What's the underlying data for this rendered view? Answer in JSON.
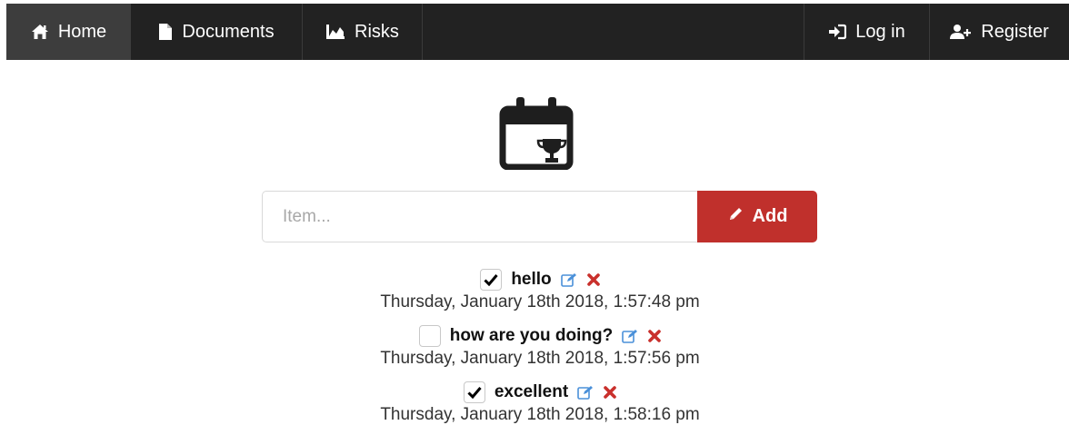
{
  "nav": {
    "left": [
      {
        "label": "Home",
        "icon": "home-icon",
        "active": true
      },
      {
        "label": "Documents",
        "icon": "document-icon",
        "active": false
      },
      {
        "label": "Risks",
        "icon": "chart-icon",
        "active": false
      }
    ],
    "right": [
      {
        "label": "Log in",
        "icon": "sign-in-icon"
      },
      {
        "label": "Register",
        "icon": "user-plus-icon"
      }
    ]
  },
  "hero": {
    "icon": "calendar-trophy-icon"
  },
  "form": {
    "placeholder": "Item...",
    "add_label": "Add",
    "add_icon": "pencil-icon"
  },
  "todos": [
    {
      "text": "hello",
      "checked": true,
      "date": "Thursday, January 18th 2018, 1:57:48 pm"
    },
    {
      "text": "how are you doing?",
      "checked": false,
      "date": "Thursday, January 18th 2018, 1:57:56 pm"
    },
    {
      "text": "excellent",
      "checked": true,
      "date": "Thursday, January 18th 2018, 1:58:16 pm"
    }
  ],
  "colors": {
    "navbar": "#222222",
    "nav_active": "#3d3d3d",
    "add_button": "#c0302c",
    "edit_icon": "#4a90d9",
    "delete_icon": "#c9302c"
  }
}
